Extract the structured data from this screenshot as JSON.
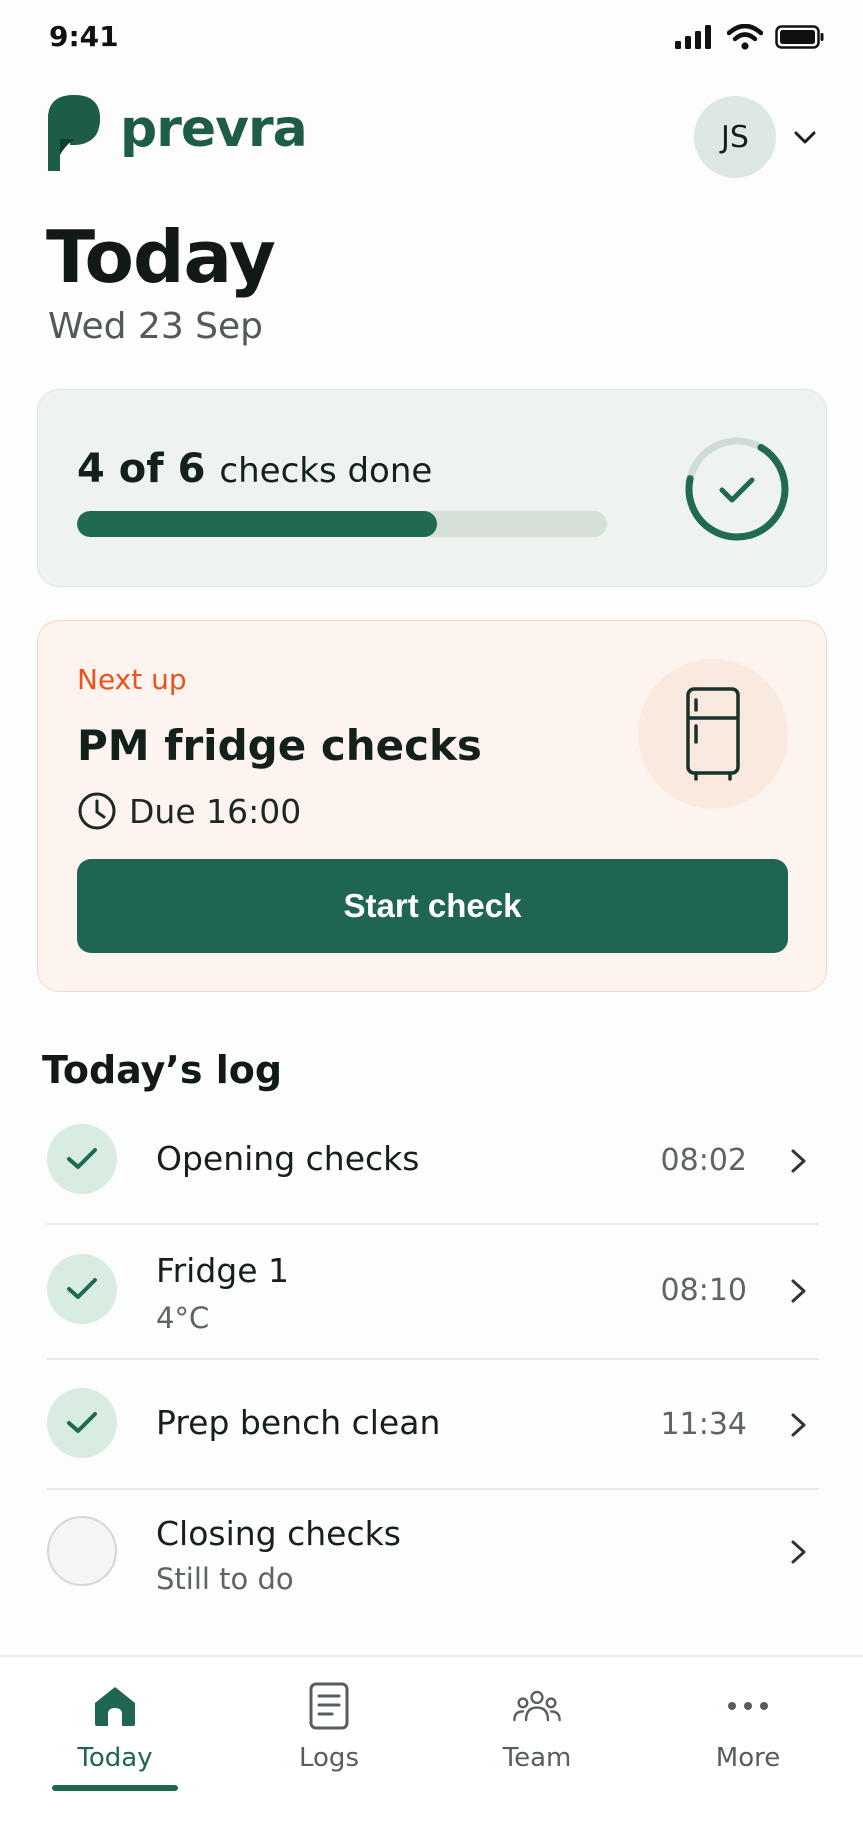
{
  "status_bar": {
    "time": "9:41",
    "icons": [
      "signal-icon",
      "wifi-icon",
      "battery-icon"
    ]
  },
  "brand": {
    "name": "prevra",
    "color": "#1d5c46"
  },
  "user": {
    "initials": "JS"
  },
  "header": {
    "title": "Today",
    "date": "Wed 23 Sep"
  },
  "progress": {
    "count_text": "4 of 6",
    "suffix": "checks done",
    "done": 4,
    "total": 6,
    "fraction": 0.68
  },
  "next_up": {
    "label": "Next up",
    "title": "PM fridge checks",
    "due": "Due 16:00",
    "button_label": "Start check",
    "accent": "#e8541c"
  },
  "log": {
    "title": "Today’s log",
    "items": [
      {
        "name": "Opening checks",
        "sub": "",
        "time": "08:02",
        "done": true
      },
      {
        "name": "Fridge 1",
        "sub": "4°C",
        "time": "08:10",
        "done": true
      },
      {
        "name": "Prep bench clean",
        "sub": "",
        "time": "11:34",
        "done": true
      },
      {
        "name": "Closing checks",
        "sub": "Still to do",
        "time": "",
        "done": false
      }
    ]
  },
  "nav": {
    "items": [
      {
        "label": "Today",
        "icon": "home-icon",
        "active": true
      },
      {
        "label": "Logs",
        "icon": "document-icon",
        "active": false
      },
      {
        "label": "Team",
        "icon": "team-icon",
        "active": false
      },
      {
        "label": "More",
        "icon": "more-icon",
        "active": false
      }
    ]
  },
  "colors": {
    "primary": "#1f6652",
    "success_bg": "#d9ece1"
  }
}
